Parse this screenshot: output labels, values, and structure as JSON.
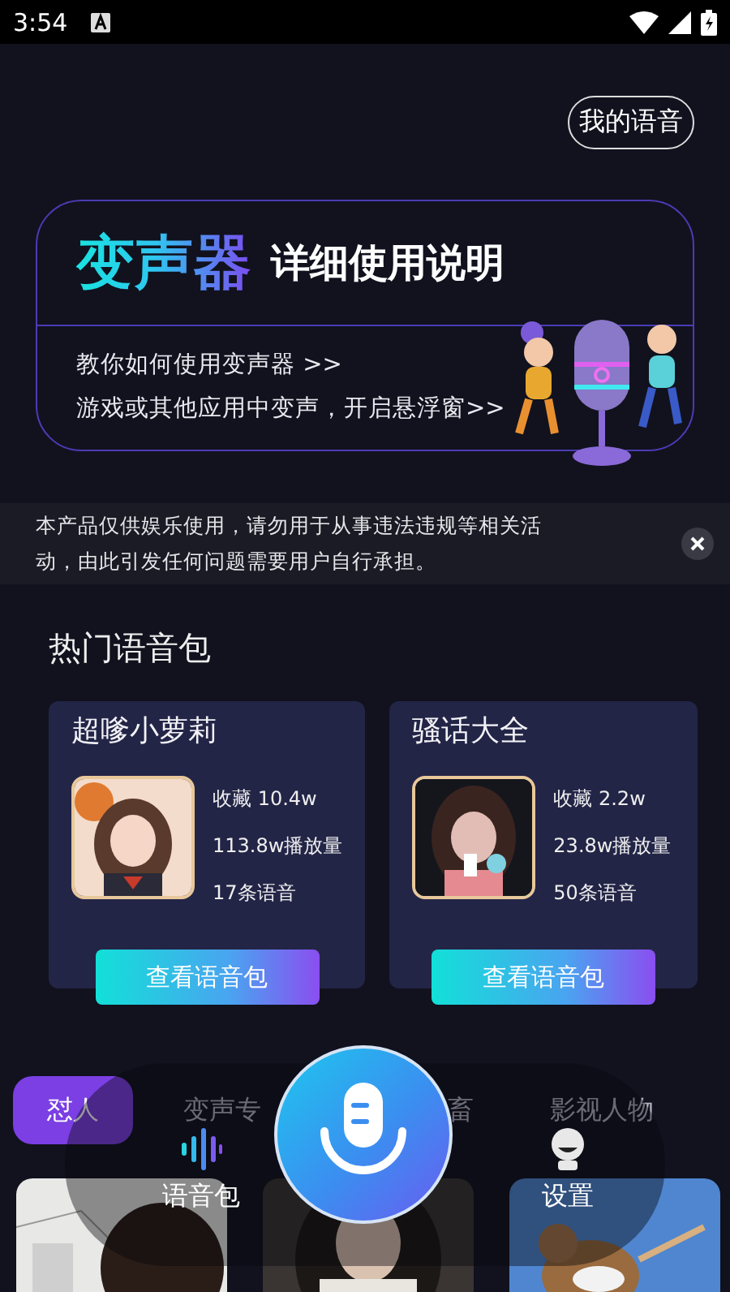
{
  "status_bar": {
    "time": "3:54"
  },
  "header": {
    "my_voice_button": "我的语音"
  },
  "banner": {
    "title_highlight": "变声器",
    "title": "详细使用说明",
    "links": [
      "教你如何使用变声器 >>",
      "游戏或其他应用中变声，开启悬浮窗>>"
    ]
  },
  "notice": {
    "text": "本产品仅供娱乐使用，请勿用于从事违法违规等相关活动，由此引发任何问题需要用户自行承担。"
  },
  "hot_packs": {
    "title": "热门语音包",
    "items": [
      {
        "name": "超嗲小萝莉",
        "favorites": "收藏 10.4w",
        "plays": "113.8w播放量",
        "count": "17条语音",
        "button": "查看语音包"
      },
      {
        "name": "骚话大全",
        "favorites": "收藏 2.2w",
        "plays": "23.8w播放量",
        "count": "50条语音",
        "button": "查看语音包"
      }
    ]
  },
  "categories": [
    {
      "label": "怼人",
      "selected": true
    },
    {
      "label": "变声专",
      "selected": false
    },
    {
      "label": "畜",
      "selected": false
    },
    {
      "label": "影视人物",
      "selected": false
    }
  ],
  "bottom_nav": {
    "items": [
      {
        "label": "语音包",
        "kind": "voice"
      },
      {
        "label": "设置",
        "kind": "settings"
      }
    ]
  }
}
